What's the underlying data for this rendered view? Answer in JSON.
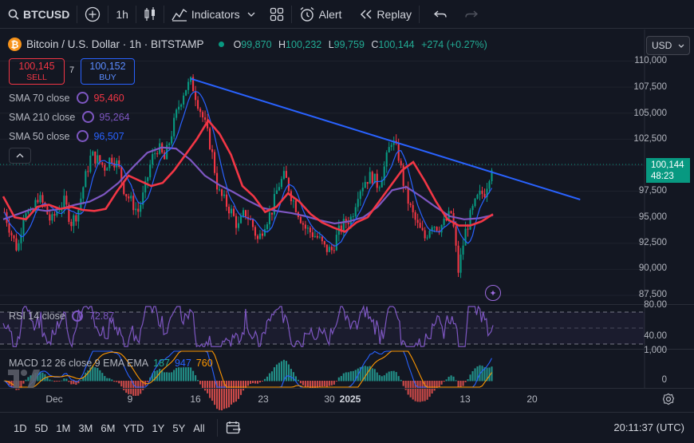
{
  "toolbar": {
    "symbol": "BTCUSD",
    "interval": "1h",
    "indicators_label": "Indicators",
    "alert_label": "Alert",
    "replay_label": "Replay"
  },
  "legend": {
    "title": "Bitcoin / U.S. Dollar · 1h · BITSTAMP",
    "open_key": "O",
    "open": "99,870",
    "high_key": "H",
    "high": "100,232",
    "low_key": "L",
    "low": "99,759",
    "close_key": "C",
    "close": "100,144",
    "change": "+274 (+0.27%)"
  },
  "trade": {
    "sell_price": "100,145",
    "sell_label": "SELL",
    "spread": "7",
    "buy_price": "100,152",
    "buy_label": "BUY"
  },
  "indicators": [
    {
      "name": "SMA 70 close",
      "value": "95,460",
      "color": "#f23645"
    },
    {
      "name": "SMA 210 close",
      "value": "95,264",
      "color": "#7e57c2"
    },
    {
      "name": "SMA 50 close",
      "value": "96,507",
      "color": "#2962ff"
    }
  ],
  "currency": "USD",
  "price_axis": [
    "110,000",
    "107,500",
    "105,000",
    "102,500",
    "97,500",
    "95,000",
    "92,500",
    "90,000",
    "87,500"
  ],
  "last_price": {
    "value": "100,144",
    "countdown": "48:23"
  },
  "rsi": {
    "label": "RSI 14 close",
    "value": "72.87",
    "levels": [
      "80.00",
      "40.00"
    ]
  },
  "macd": {
    "label": "MACD 12 26 close 9 EMA EMA",
    "hist": "187",
    "macd": "947",
    "signal": "760",
    "axis": [
      "1,000",
      "0"
    ]
  },
  "time_axis": [
    {
      "label": "Dec",
      "bold": false
    },
    {
      "label": "9",
      "bold": false
    },
    {
      "label": "16",
      "bold": false
    },
    {
      "label": "23",
      "bold": false
    },
    {
      "label": "30",
      "bold": false
    },
    {
      "label": "2025",
      "bold": true
    },
    {
      "label": "13",
      "bold": false
    },
    {
      "label": "20",
      "bold": false
    }
  ],
  "ranges": [
    "1D",
    "5D",
    "1M",
    "3M",
    "6M",
    "YTD",
    "1Y",
    "5Y",
    "All"
  ],
  "clock": "20:11:37 (UTC)",
  "chart_data": {
    "type": "candlestick",
    "symbol": "BTCUSD",
    "interval": "1h",
    "ylim": [
      86500,
      110500
    ],
    "price_path": [
      [
        0,
        95500
      ],
      [
        1,
        93500
      ],
      [
        2,
        91800
      ],
      [
        3,
        96000
      ],
      [
        4,
        95000
      ],
      [
        5,
        97000
      ],
      [
        6,
        96000
      ],
      [
        7,
        94500
      ],
      [
        8,
        95800
      ],
      [
        9,
        96500
      ],
      [
        10,
        94500
      ],
      [
        11,
        95500
      ],
      [
        12,
        98500
      ],
      [
        13,
        101000
      ],
      [
        14,
        100500
      ],
      [
        15,
        99800
      ],
      [
        16,
        100800
      ],
      [
        17,
        100000
      ],
      [
        18,
        97500
      ],
      [
        19,
        96500
      ],
      [
        20,
        95500
      ],
      [
        21,
        97500
      ],
      [
        22,
        100500
      ],
      [
        23,
        101800
      ],
      [
        24,
        100500
      ],
      [
        25,
        103000
      ],
      [
        26,
        105500
      ],
      [
        27,
        107300
      ],
      [
        28,
        108000
      ],
      [
        29,
        106000
      ],
      [
        30,
        104000
      ],
      [
        31,
        101500
      ],
      [
        32,
        97500
      ],
      [
        33,
        96500
      ],
      [
        34,
        95500
      ],
      [
        35,
        94000
      ],
      [
        36,
        95500
      ],
      [
        37,
        94500
      ],
      [
        38,
        92700
      ],
      [
        39,
        94500
      ],
      [
        40,
        95500
      ],
      [
        41,
        98000
      ],
      [
        42,
        99000
      ],
      [
        43,
        97000
      ],
      [
        44,
        95500
      ],
      [
        45,
        94000
      ],
      [
        46,
        93500
      ],
      [
        47,
        93000
      ],
      [
        48,
        92000
      ],
      [
        49,
        91800
      ],
      [
        50,
        93500
      ],
      [
        51,
        94500
      ],
      [
        52,
        95000
      ],
      [
        53,
        97500
      ],
      [
        54,
        98500
      ],
      [
        55,
        99000
      ],
      [
        56,
        98000
      ],
      [
        57,
        100000
      ],
      [
        58,
        102500
      ],
      [
        59,
        101000
      ],
      [
        60,
        97500
      ],
      [
        61,
        95500
      ],
      [
        62,
        94000
      ],
      [
        63,
        93000
      ],
      [
        64,
        94500
      ],
      [
        65,
        94000
      ],
      [
        66,
        94500
      ],
      [
        67,
        95500
      ],
      [
        68,
        89800
      ],
      [
        69,
        93500
      ],
      [
        70,
        95500
      ],
      [
        71,
        97000
      ],
      [
        72,
        97500
      ],
      [
        73,
        100000
      ]
    ],
    "sma70": [
      [
        0,
        97000
      ],
      [
        1,
        95000
      ],
      [
        2,
        94800
      ],
      [
        3,
        96000
      ],
      [
        4,
        96200
      ],
      [
        5,
        95800
      ],
      [
        6,
        96000
      ],
      [
        7,
        95700
      ],
      [
        8,
        95600
      ],
      [
        9,
        95800
      ],
      [
        10,
        97500
      ],
      [
        11,
        99000
      ],
      [
        12,
        98500
      ],
      [
        13,
        98000
      ],
      [
        14,
        98300
      ],
      [
        15,
        99500
      ],
      [
        16,
        101000
      ],
      [
        17,
        102500
      ],
      [
        18,
        104300
      ],
      [
        19,
        103000
      ],
      [
        20,
        101000
      ],
      [
        21,
        98000
      ],
      [
        22,
        97000
      ],
      [
        23,
        95500
      ],
      [
        24,
        96000
      ],
      [
        25,
        97300
      ],
      [
        26,
        96500
      ],
      [
        27,
        95300
      ],
      [
        28,
        94500
      ],
      [
        29,
        94000
      ],
      [
        30,
        93600
      ],
      [
        31,
        94500
      ],
      [
        32,
        95000
      ],
      [
        33,
        96500
      ],
      [
        34,
        98000
      ],
      [
        35,
        99500
      ],
      [
        36,
        100300
      ],
      [
        37,
        98500
      ],
      [
        38,
        96500
      ],
      [
        39,
        94800
      ],
      [
        40,
        94200
      ],
      [
        41,
        94200
      ],
      [
        42,
        94600
      ],
      [
        43,
        95300
      ]
    ],
    "sma210": [
      [
        0,
        94800
      ],
      [
        1,
        95300
      ],
      [
        2,
        95800
      ],
      [
        3,
        95600
      ],
      [
        4,
        95800
      ],
      [
        5,
        96200
      ],
      [
        6,
        96500
      ],
      [
        7,
        97200
      ],
      [
        8,
        98300
      ],
      [
        9,
        99800
      ],
      [
        10,
        101200
      ],
      [
        11,
        101700
      ],
      [
        12,
        101600
      ],
      [
        13,
        100500
      ],
      [
        14,
        99000
      ],
      [
        15,
        98100
      ],
      [
        16,
        97400
      ],
      [
        17,
        96600
      ],
      [
        18,
        95900
      ],
      [
        19,
        95600
      ],
      [
        20,
        95400
      ],
      [
        21,
        95100
      ],
      [
        22,
        94700
      ],
      [
        23,
        94400
      ],
      [
        24,
        94600
      ],
      [
        25,
        95000
      ],
      [
        26,
        96000
      ],
      [
        27,
        97600
      ],
      [
        28,
        97900
      ],
      [
        29,
        97000
      ],
      [
        30,
        96000
      ],
      [
        31,
        95100
      ],
      [
        32,
        94800
      ],
      [
        33,
        94900
      ],
      [
        34,
        95200
      ]
    ],
    "trendline": {
      "start": [
        28,
        108300
      ],
      "end": [
        86,
        96700
      ]
    }
  }
}
